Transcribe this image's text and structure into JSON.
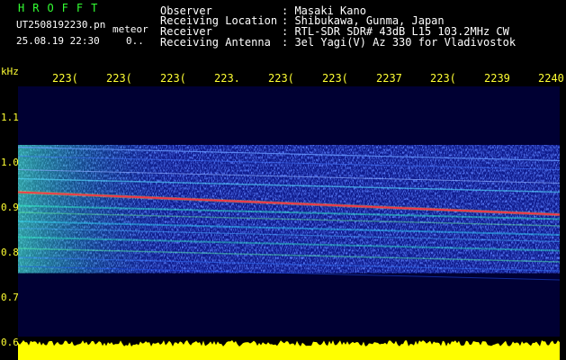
{
  "header": {
    "title": "HROFFT",
    "filename": "UT2508192230.pn",
    "meteor_label": "meteor",
    "datetime": "25.08.19 22:30",
    "misc": "0.."
  },
  "info": [
    {
      "label": "Observer",
      "value": ": Masaki Kano"
    },
    {
      "label": "Receiving Location",
      "value": ": Shibukawa, Gunma, Japan"
    },
    {
      "label": "Receiver",
      "value": ": RTL-SDR SDR# 43dB L15 103.2MHz CW"
    },
    {
      "label": "Receiving Antenna",
      "value": ": 3el Yagi(V) Az 330 for Vladivostok"
    }
  ],
  "chart_data": {
    "type": "heatmap",
    "ylabel": "kHz",
    "y_ticks": [
      "1.1",
      "1.0",
      "0.9",
      "0.8",
      "0.7",
      "0.6"
    ],
    "ylim": [
      0.6,
      1.15
    ],
    "x_ticks": [
      "223(",
      "223(",
      "223(",
      "223.",
      "223(",
      "223(",
      "2237",
      "223(",
      "2239",
      "2240"
    ],
    "active_band_khz": [
      0.755,
      1.04
    ],
    "carrier_khz_start": 0.935,
    "carrier_khz_end": 0.885,
    "colors": {
      "background": "#000033",
      "noise": "#1a2fd6",
      "carrier": "#ff3344",
      "bottom_band": "#ffff00",
      "axis": "#ffff33",
      "title": "#33ff33"
    }
  }
}
